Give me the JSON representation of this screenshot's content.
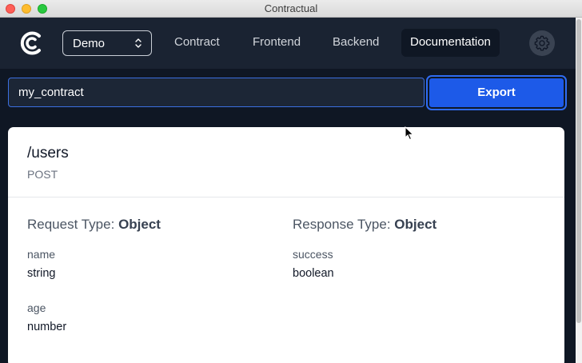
{
  "window": {
    "title": "Contractual"
  },
  "nav": {
    "project_select": {
      "value": "Demo"
    },
    "items": [
      {
        "label": "Contract",
        "active": false
      },
      {
        "label": "Frontend",
        "active": false
      },
      {
        "label": "Backend",
        "active": false
      },
      {
        "label": "Documentation",
        "active": true
      }
    ],
    "settings_icon": "gear-icon",
    "logo_icon": "contractual-logo"
  },
  "contract": {
    "name": "my_contract",
    "export_label": "Export"
  },
  "endpoint": {
    "path": "/users",
    "method": "POST",
    "request": {
      "label": "Request Type:",
      "type": "Object",
      "fields": [
        {
          "name": "name",
          "type": "string"
        },
        {
          "name": "age",
          "type": "number"
        }
      ]
    },
    "response": {
      "label": "Response Type:",
      "type": "Object",
      "fields": [
        {
          "name": "success",
          "type": "boolean"
        }
      ]
    }
  },
  "colors": {
    "background": "#0f1724",
    "navbar": "#1a2332",
    "accent": "#1d5ae8",
    "card": "#ffffff"
  }
}
